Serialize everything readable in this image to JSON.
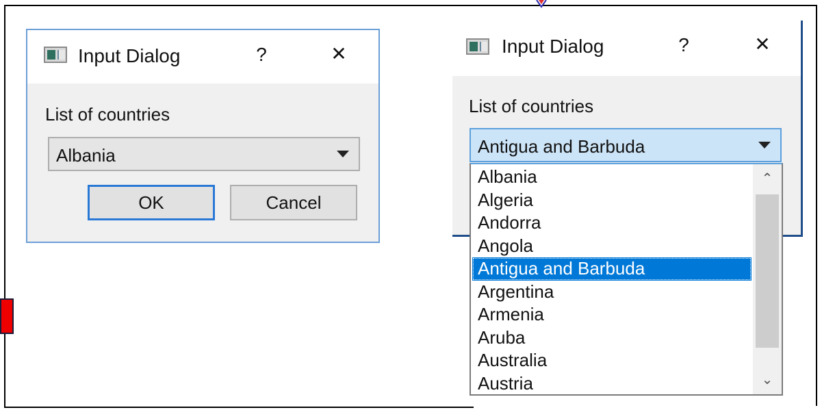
{
  "dialog1": {
    "title": "Input Dialog",
    "help_label": "?",
    "close_label": "✕",
    "prompt_label": "List of countries",
    "combo_value": "Albania",
    "ok_label": "OK",
    "cancel_label": "Cancel"
  },
  "dialog2": {
    "title": "Input Dialog",
    "help_label": "?",
    "close_label": "✕",
    "prompt_label": "List of countries",
    "combo_value": "Antigua and Barbuda",
    "dropdown_items": [
      "Albania",
      "Algeria",
      "Andorra",
      "Angola",
      "Antigua and Barbuda",
      "Argentina",
      "Armenia",
      "Aruba",
      "Australia",
      "Austria"
    ],
    "selected_item": "Antigua and Barbuda",
    "scroll_up_glyph": "⌃",
    "scroll_down_glyph": "⌄"
  },
  "colors": {
    "accent": "#0078d7",
    "dialog_bg": "#f0f0f0",
    "focus_border": "#2a78d6",
    "marker_red": "#ee0000"
  },
  "icons": [
    "app-window-icon",
    "help-icon",
    "close-icon",
    "dropdown-arrow-icon",
    "scroll-up-icon",
    "scroll-down-icon"
  ]
}
